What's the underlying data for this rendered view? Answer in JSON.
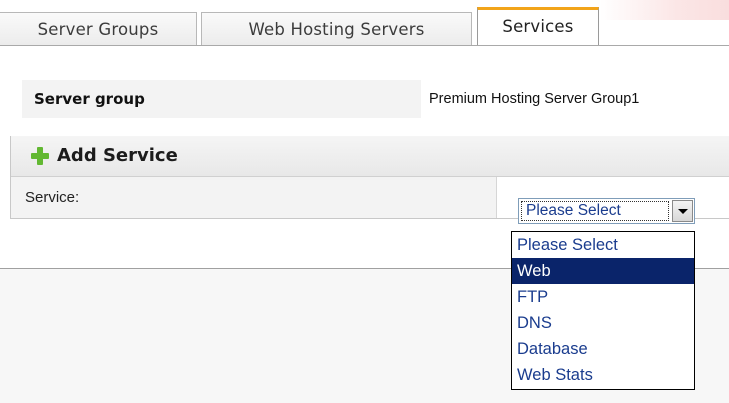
{
  "tabs": [
    {
      "label": "Server Groups",
      "active": false
    },
    {
      "label": "Web Hosting Servers",
      "active": false
    },
    {
      "label": "Services",
      "active": true
    }
  ],
  "server_group": {
    "label": "Server group",
    "value": "Premium Hosting Server Group1"
  },
  "add_service": {
    "title": "Add Service",
    "icon": "plus-icon",
    "service_label": "Service:",
    "select": {
      "selected": "Please Select",
      "options": [
        "Please Select",
        "Web",
        "FTP",
        "DNS",
        "Database",
        "Web Stats"
      ],
      "highlighted_index": 1
    }
  },
  "colors": {
    "active_tab_accent": "#f2a419",
    "plus_icon": "#62b832",
    "highlight": "#0a246a",
    "option_text": "#1a3c8e"
  }
}
